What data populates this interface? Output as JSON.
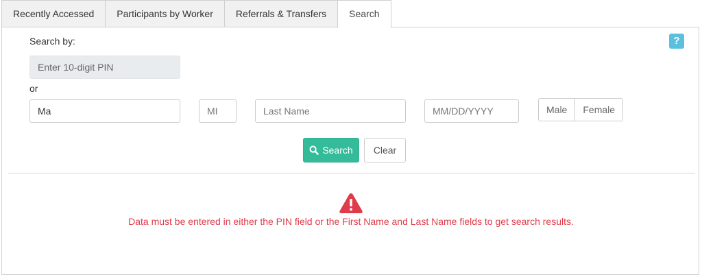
{
  "tabs": [
    {
      "label": "Recently Accessed",
      "active": false
    },
    {
      "label": "Participants by Worker",
      "active": false
    },
    {
      "label": "Referrals & Transfers",
      "active": false
    },
    {
      "label": "Search",
      "active": true
    }
  ],
  "help": {
    "label": "?",
    "color": "#5bc0de"
  },
  "search_form": {
    "search_by_label": "Search by:",
    "pin_placeholder": "Enter 10-digit PIN",
    "or_label": "or",
    "first_name_value": "Ma",
    "mi_placeholder": "MI",
    "last_name_placeholder": "Last Name",
    "dob_placeholder": "MM/DD/YYYY",
    "gender_options": [
      "Male",
      "Female"
    ],
    "search_button_label": "Search",
    "search_icon": "search-icon",
    "clear_button_label": "Clear"
  },
  "message": {
    "icon": "warning-triangle-icon",
    "text": "Data must be entered in either the PIN field or the First Name and Last Name fields to get search results.",
    "color": "#e03b4b"
  },
  "colors": {
    "accent": "#34bc9a",
    "error": "#e03b4b",
    "info": "#5bc0de"
  }
}
